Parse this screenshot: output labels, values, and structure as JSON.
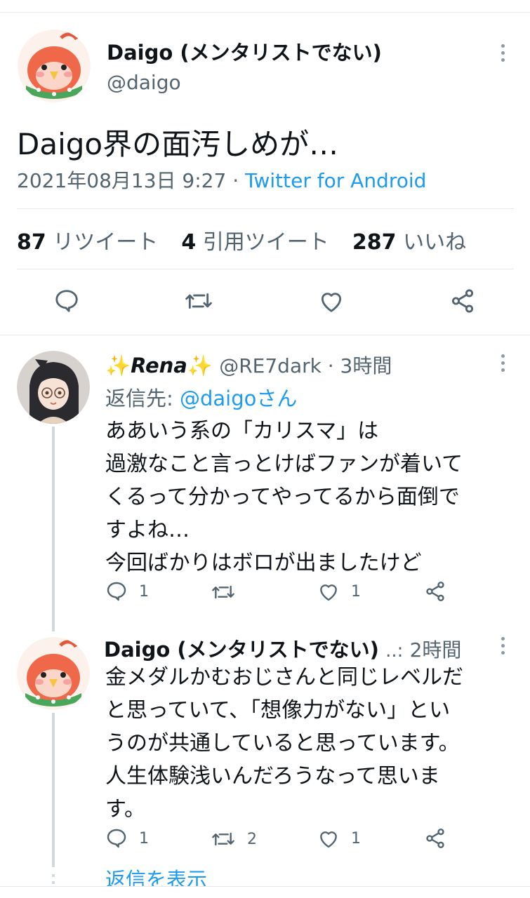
{
  "main_tweet": {
    "display_name": "Daigo (メンタリストでない)",
    "handle": "@daigo",
    "text": "Daigo界の面汚しめが…",
    "date": "2021年08月13日 9:27",
    "separator": "·",
    "source": "Twitter for Android",
    "stats": {
      "retweets_count": "87",
      "retweets_label": "リツイート",
      "quotes_count": "4",
      "quotes_label": "引用ツイート",
      "likes_count": "287",
      "likes_label": "いいね"
    },
    "actions": [
      "reply-icon",
      "retweet-icon",
      "like-icon",
      "share-icon"
    ]
  },
  "reply1": {
    "sparkle_left": "✨",
    "display_name": "Rena",
    "sparkle_right": "✨",
    "handle_time": "@RE7dark · 3時間",
    "replying_prefix": "返信先:",
    "replying_to": "@daigoさん",
    "lines": [
      "ああいう系の「カリスマ」は",
      "過激なこと言っとけばファンが着いて",
      "くるって分かってやってるから面倒で",
      "すよね…",
      "今回ばかりはボロが出ましたけど"
    ],
    "reply_count": "1",
    "retweet_count": "",
    "like_count": "1"
  },
  "reply2": {
    "display_name": "Daigo (メンタリストでない)",
    "ellipsis": "..:",
    "time": "2時間",
    "lines": [
      "金メダルかむおじさんと同じレベルだ",
      "と思っていて、「想像力がない」とい",
      "うのが共通していると思っています。",
      "人生体験浅いんだろうなって思いま",
      "す。"
    ],
    "reply_count": "1",
    "retweet_count": "2",
    "like_count": "1"
  },
  "show_replies": "返信を表示",
  "colors": {
    "accent": "#1d9bf0",
    "muted": "#536471",
    "divider": "#e6e9ec"
  }
}
